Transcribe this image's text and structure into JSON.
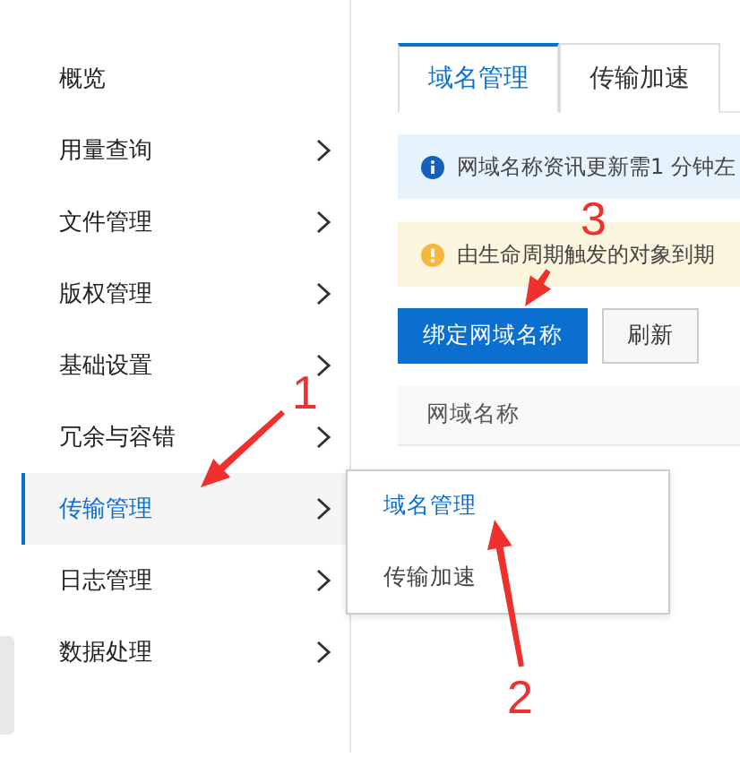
{
  "sidebar": {
    "items": [
      {
        "label": "概览",
        "expandable": false,
        "selected": false
      },
      {
        "label": "用量查询",
        "expandable": true,
        "selected": false
      },
      {
        "label": "文件管理",
        "expandable": true,
        "selected": false
      },
      {
        "label": "版权管理",
        "expandable": true,
        "selected": false
      },
      {
        "label": "基础设置",
        "expandable": true,
        "selected": false
      },
      {
        "label": "冗余与容错",
        "expandable": true,
        "selected": false
      },
      {
        "label": "传输管理",
        "expandable": true,
        "selected": true
      },
      {
        "label": "日志管理",
        "expandable": true,
        "selected": false
      },
      {
        "label": "数据处理",
        "expandable": true,
        "selected": false
      }
    ]
  },
  "tabs": [
    {
      "label": "域名管理",
      "selected": true
    },
    {
      "label": "传输加速",
      "selected": false
    }
  ],
  "alerts": [
    {
      "kind": "info",
      "text": "网域名称资讯更新需1 分钟左"
    },
    {
      "kind": "warning",
      "text": "由生命周期触发的对象到期"
    }
  ],
  "buttons": [
    {
      "label": "绑定网域名称",
      "kind": "primary"
    },
    {
      "label": "刷新",
      "kind": "default"
    }
  ],
  "table": {
    "columns": [
      "网域名称"
    ]
  },
  "submenu": {
    "items": [
      {
        "label": "域名管理",
        "selected": true
      },
      {
        "label": "传输加速",
        "selected": false
      }
    ]
  },
  "annotations": [
    {
      "label": "1"
    },
    {
      "label": "2"
    },
    {
      "label": "3"
    }
  ]
}
